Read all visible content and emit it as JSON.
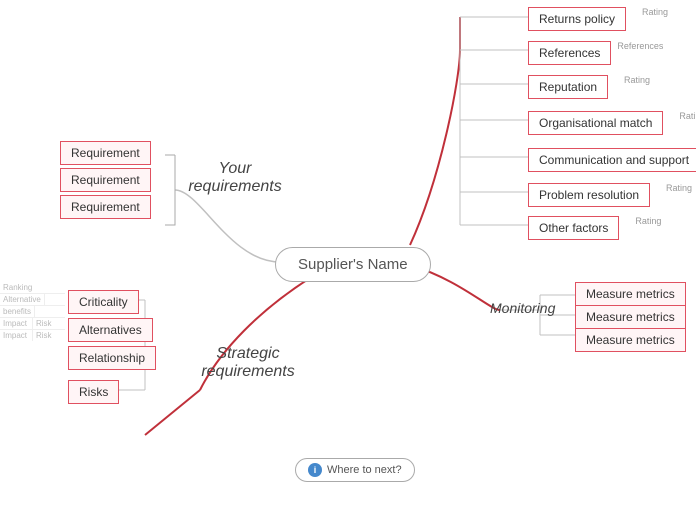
{
  "center": {
    "label": "Supplier's Name"
  },
  "requirements": {
    "title": "Your\nrequirements",
    "items": [
      "Requirement",
      "Requirement",
      "Requirement"
    ]
  },
  "strategic": {
    "title": "Strategic\nrequirements",
    "items": [
      "Criticality",
      "Alternatives",
      "Relationship",
      "Risks"
    ]
  },
  "evaluation": {
    "items": [
      {
        "label": "Returns policy",
        "tag": "Rating",
        "tagType": "right"
      },
      {
        "label": "References",
        "tag": "References",
        "tagType": "right"
      },
      {
        "label": "Reputation",
        "tag": "Rating",
        "tagType": "right"
      },
      {
        "label": "Organisational match",
        "tag": "Rating",
        "tagType": "right"
      },
      {
        "label": "Communication and support",
        "tag": "",
        "tagType": "none"
      },
      {
        "label": "Problem resolution",
        "tag": "Rating",
        "tagType": "right"
      },
      {
        "label": "Other factors",
        "tag": "Rating",
        "tagType": "right"
      }
    ]
  },
  "monitoring": {
    "label": "Monitoring",
    "items": [
      "Measure metrics",
      "Measure metrics",
      "Measure metrics"
    ]
  },
  "table": {
    "headers": [
      "Ranking",
      ""
    ],
    "rows": [
      [
        "Alternative",
        ""
      ],
      [
        "benefits",
        ""
      ],
      [
        "Impact",
        "Risk"
      ],
      [
        "Impact",
        "Risk"
      ]
    ]
  },
  "whereNext": {
    "label": "Where to next?"
  }
}
